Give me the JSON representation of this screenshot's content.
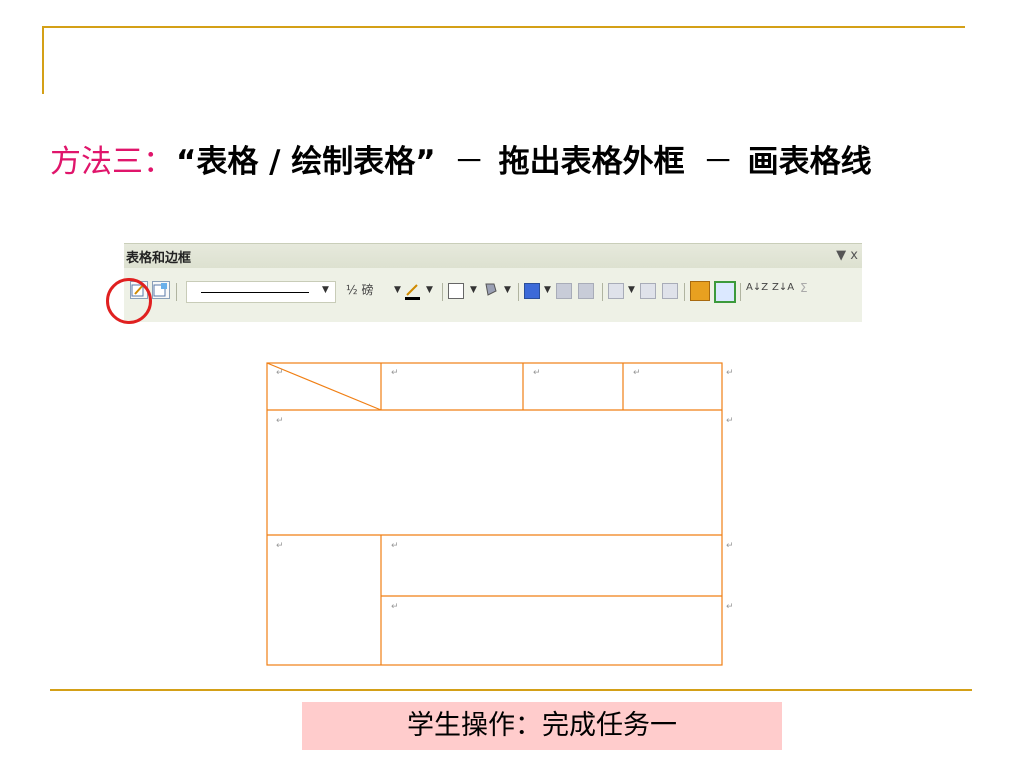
{
  "headline": {
    "method_label": "方法三",
    "colon": "：",
    "step1": "“表格 / 绘制表格”",
    "sep1": "－",
    "step2": "拖出表格外框",
    "sep2": "－",
    "step3": "画表格线"
  },
  "toolbar": {
    "title": "表格和边框",
    "menu_symbol": "▼ x",
    "width_label": "½ 磅",
    "sort_labels": [
      "A↓Z",
      "Z↓A"
    ],
    "sum_symbol": "Σ"
  },
  "table": {
    "para_mark": "↵"
  },
  "bottom": {
    "label": "学生操作：完成任务一"
  },
  "colors": {
    "accent": "#d4a017",
    "highlight": "#e0156b",
    "table_border": "#f07f14",
    "circle": "#e02020",
    "bottom_box": "#ffcccc"
  }
}
